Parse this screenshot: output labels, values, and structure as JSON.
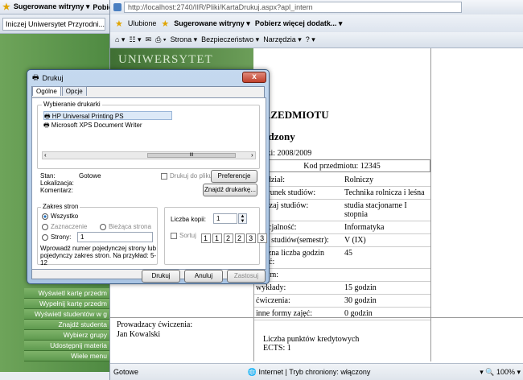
{
  "bg_browser": {
    "favbar_label": "Sugerowane witryny ▾",
    "favbar_extra": "Pobie",
    "tab_title": "Iniczej Uniwersytet Przyrodni...",
    "menu_items": [
      "Wyświetl kartę przedm",
      "Wypełnij kartę przedm",
      "Wyświetl studentów w g",
      "Znajdź studenta",
      "Wybierz grupy",
      "Udostępnij materia",
      "Wiele menu"
    ]
  },
  "ie": {
    "url": "http://localhost:2740/IIR/Pliki/KartaDrukuj.aspx?apl_intern",
    "favbar": {
      "favorites": "Ulubione",
      "suggested": "Sugerowane witryny ▾",
      "more": "Pobierz więcej dodatk... ▾"
    },
    "cmdbar": {
      "page": "Strona ▾",
      "security": "Bezpieczeństwo ▾",
      "tools": "Narzędzia ▾"
    },
    "status": {
      "left": "Gotowe",
      "zone": "Internet | Tryb chroniony: włączony",
      "zoom": "100%"
    }
  },
  "doc": {
    "banner": "UNIWERSYTET",
    "title_line1": "RZEDMIOTU",
    "title_line2": "adzony",
    "year_label": "cki: 2008/2009",
    "kod_label": "Kod przedmiotu: 12345",
    "rows": [
      {
        "k": "Wydział:",
        "v": "Rolniczy"
      },
      {
        "k": "Kierunek studiów:",
        "v": "Technika rolnicza i leśna"
      },
      {
        "k": "Rodzaj studiów:",
        "v": "studia stacjonarne I stopnia"
      },
      {
        "k": "Specjalność:",
        "v": "Informatyka"
      },
      {
        "k": "Rok studiów(semestr):",
        "v": "V (IX)"
      },
      {
        "k": "Łączna liczba godzin zajęć:",
        "v": "45"
      },
      {
        "k": "w tym:",
        "v": ""
      },
      {
        "k": "wykłady:",
        "v": "15 godzin"
      },
      {
        "k": "ćwiczenia:",
        "v": "30 godzin"
      },
      {
        "k": "inne formy zajęć:",
        "v": "0 godzin"
      }
    ],
    "prow_label": "Prowadzacy ćwiczenia:",
    "prow_name": "Jan Kowalski",
    "ects": "Liczba punktów kredytowych ECTS: 1"
  },
  "dialog": {
    "title": "Drukuj",
    "close": "x",
    "tabs": [
      "Ogólne",
      "Opcje"
    ],
    "select_printer_label": "Wybieranie drukarki",
    "printers": [
      "HP Universal Printing PS",
      "Microsoft XPS Document Writer"
    ],
    "scroll_mark": "III",
    "status_label": "Stan:",
    "status_value": "Gotowe",
    "location_label": "Lokalizacja:",
    "comment_label": "Komentarz:",
    "print_to_file": "Drukuj do pliku",
    "preferences": "Preferencje",
    "find_printer": "Znajdź drukarkę...",
    "range_label": "Zakres stron",
    "all": "Wszystko",
    "selection": "Zaznaczenie",
    "current_page": "Bieżąca strona",
    "pages": "Strony:",
    "pages_value": "1",
    "hint": "Wprowadź numer pojedynczej strony lub pojedynczy zakres stron. Na przykład: 5-12",
    "copies_label": "Liczba kopii:",
    "copies_value": "1",
    "collate": "Sortuj",
    "collate_icons": [
      "1",
      "1",
      "2",
      "2",
      "3",
      "3"
    ],
    "print_btn": "Drukuj",
    "cancel_btn": "Anuluj",
    "apply_btn": "Zastosuj"
  }
}
